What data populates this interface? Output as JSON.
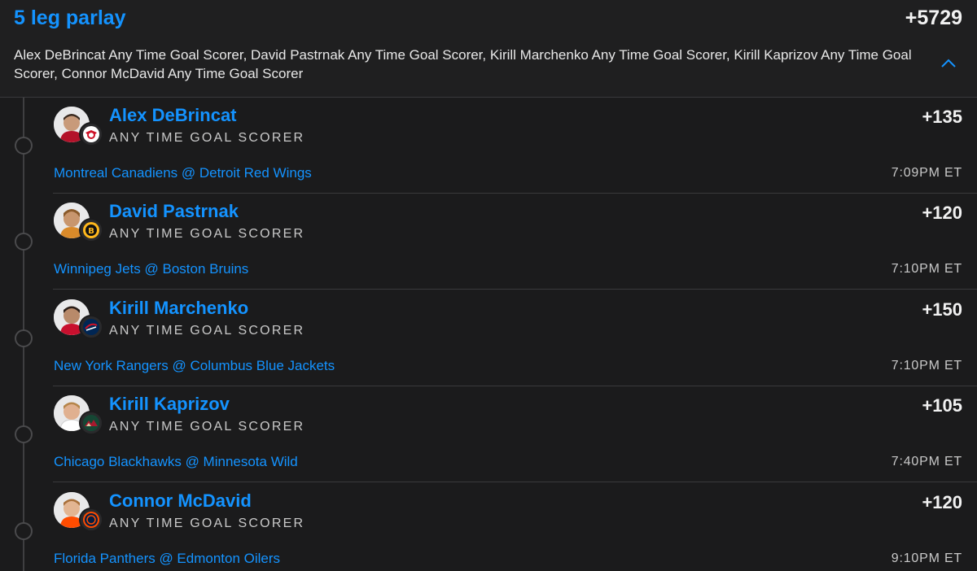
{
  "header": {
    "title": "5 leg parlay",
    "odds": "+5729",
    "summary": "Alex DeBrincat Any Time Goal Scorer, David Pastrnak Any Time Goal Scorer, Kirill Marchenko Any Time Goal Scorer, Kirill Kaprizov Any Time Goal Scorer, Connor McDavid Any Time Goal Scorer",
    "collapse_icon": "chevron-up-icon"
  },
  "colors": {
    "accent": "#1493ff",
    "background": "#1b1b1c",
    "divider": "#3a3a3c"
  },
  "legs": [
    {
      "player": "Alex DeBrincat",
      "market": "ANY TIME GOAL SCORER",
      "price": "+135",
      "game": "Montreal Canadiens @ Detroit Red Wings",
      "time": "7:09PM ET",
      "team_logo": "detroit-red-wings-logo"
    },
    {
      "player": "David Pastrnak",
      "market": "ANY TIME GOAL SCORER",
      "price": "+120",
      "game": "Winnipeg Jets @ Boston Bruins",
      "time": "7:10PM ET",
      "team_logo": "boston-bruins-logo"
    },
    {
      "player": "Kirill Marchenko",
      "market": "ANY TIME GOAL SCORER",
      "price": "+150",
      "game": "New York Rangers @ Columbus Blue Jackets",
      "time": "7:10PM ET",
      "team_logo": "columbus-blue-jackets-logo"
    },
    {
      "player": "Kirill Kaprizov",
      "market": "ANY TIME GOAL SCORER",
      "price": "+105",
      "game": "Chicago Blackhawks @ Minnesota Wild",
      "time": "7:40PM ET",
      "team_logo": "minnesota-wild-logo"
    },
    {
      "player": "Connor McDavid",
      "market": "ANY TIME GOAL SCORER",
      "price": "+120",
      "game": "Florida Panthers @ Edmonton Oilers",
      "time": "9:10PM ET",
      "team_logo": "edmonton-oilers-logo"
    }
  ]
}
